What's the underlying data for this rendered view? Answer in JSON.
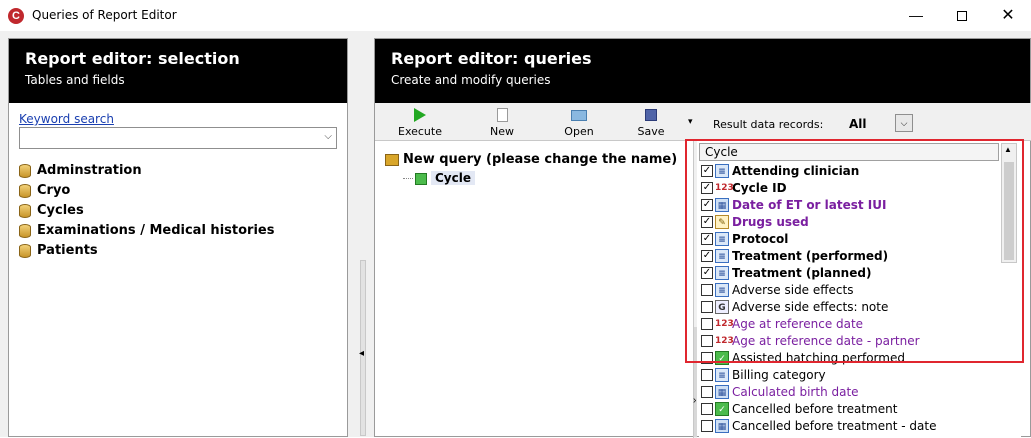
{
  "window": {
    "title": "Queries of Report Editor",
    "app_icon_glyph": "C",
    "minimize_glyph": "—",
    "close_glyph": "✕"
  },
  "left_panel": {
    "title": "Report editor: selection",
    "subtitle": "Tables and fields",
    "keyword_label": "Keyword search",
    "keyword_value": "",
    "keyword_arrow": "⌵",
    "tables": [
      "Adminstration",
      "Cryo",
      "Cycles",
      "Examinations / Medical histories",
      "Patients"
    ]
  },
  "splitter": {
    "arrow": "◂"
  },
  "right_panel": {
    "title": "Report editor: queries",
    "subtitle": "Create and modify queries",
    "toolbar": {
      "execute": "Execute",
      "new": "New",
      "open": "Open",
      "save": "Save",
      "more": "▾"
    },
    "result": {
      "label": "Result data records:",
      "value": "All",
      "dropdown_glyph": "⌵"
    },
    "query_tree": {
      "root": "New query (please change the name)",
      "child": "Cycle"
    },
    "vsep_arrow": "›",
    "field_list": {
      "header": "Cycle",
      "scroll_up": "▲",
      "fields": [
        {
          "label": "Attending clinician",
          "checked": true,
          "icon": "list",
          "style": "bold"
        },
        {
          "label": "Cycle ID",
          "checked": true,
          "icon": "num",
          "style": "bold"
        },
        {
          "label": "Date of ET or latest IUI",
          "checked": true,
          "icon": "date",
          "style": "bold-purple"
        },
        {
          "label": "Drugs used",
          "checked": true,
          "icon": "edit",
          "style": "bold-purple"
        },
        {
          "label": "Protocol",
          "checked": true,
          "icon": "list",
          "style": "bold"
        },
        {
          "label": "Treatment (performed)",
          "checked": true,
          "icon": "list",
          "style": "bold"
        },
        {
          "label": "Treatment (planned)",
          "checked": true,
          "icon": "list",
          "style": "bold"
        },
        {
          "label": "Adverse side effects",
          "checked": false,
          "icon": "list",
          "style": "normal"
        },
        {
          "label": "Adverse side effects: note",
          "checked": false,
          "icon": "memo",
          "style": "normal"
        },
        {
          "label": "Age at reference date",
          "checked": false,
          "icon": "num",
          "style": "purple"
        },
        {
          "label": "Age at reference date - partner",
          "checked": false,
          "icon": "num",
          "style": "purple"
        },
        {
          "label": "Assisted hatching performed",
          "checked": false,
          "icon": "bool",
          "style": "normal"
        },
        {
          "label": "Billing category",
          "checked": false,
          "icon": "list",
          "style": "normal"
        },
        {
          "label": "Calculated birth date",
          "checked": false,
          "icon": "date",
          "style": "purple"
        },
        {
          "label": "Cancelled before treatment",
          "checked": false,
          "icon": "bool",
          "style": "normal"
        },
        {
          "label": "Cancelled before treatment - date",
          "checked": false,
          "icon": "date",
          "style": "normal"
        }
      ]
    }
  },
  "icons": {
    "list": "≡",
    "num": "123",
    "date": "▦",
    "edit": "✎",
    "memo": "G",
    "bool": "✓"
  },
  "colors": {
    "header_bg": "#000000",
    "purple_text": "#7a1fa0",
    "highlight": "#e0262f"
  }
}
